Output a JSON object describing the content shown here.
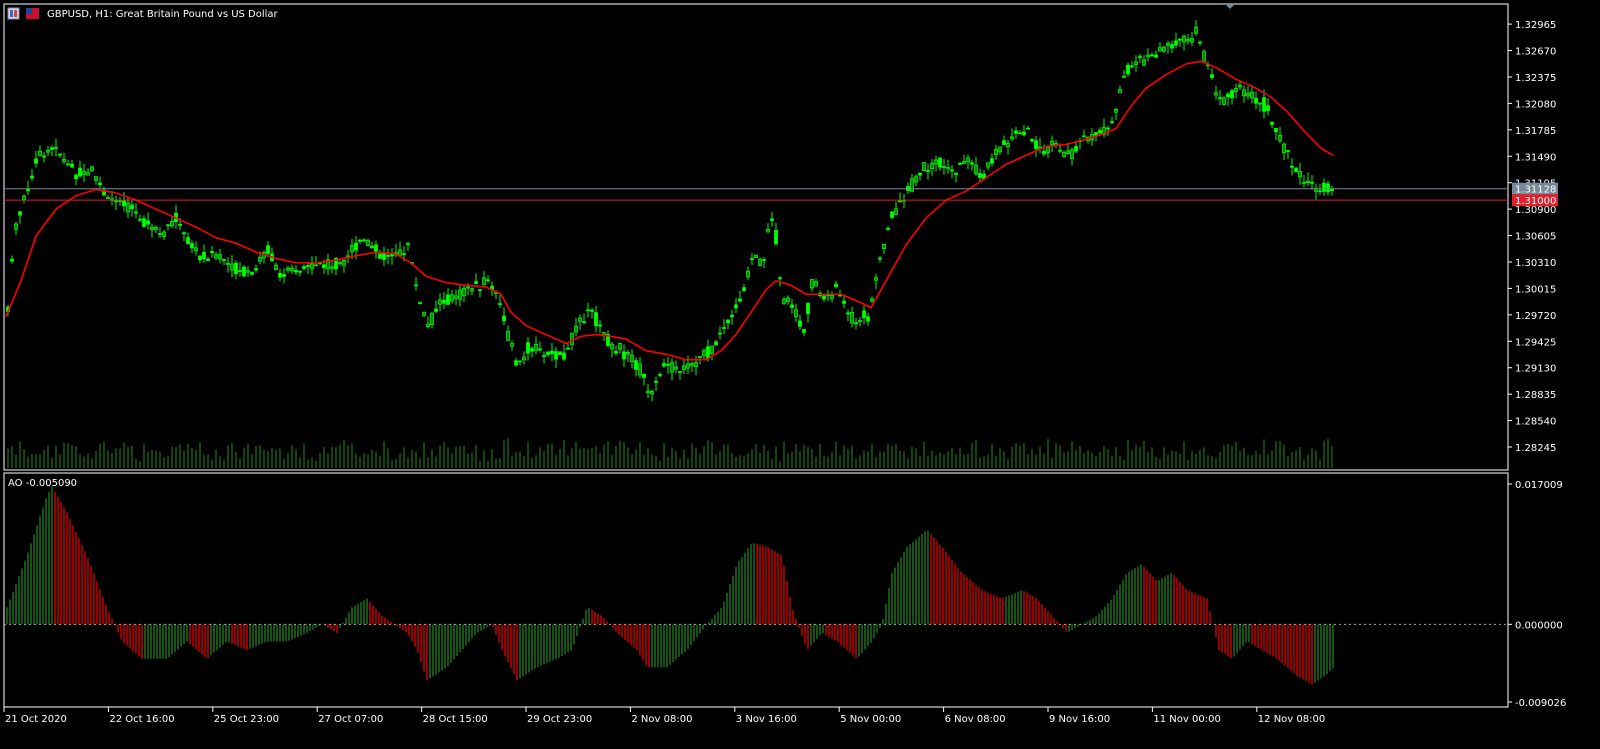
{
  "header": {
    "symbol_title": "GBPUSD, H1:  Great Britain Pound vs US Dollar",
    "ao_label": "AO -0.005090"
  },
  "price_panel": {
    "bid_line": {
      "value": 1.31128,
      "label": "1.31128",
      "color": "#778899"
    },
    "ask_line": {
      "value": 1.31,
      "label": "1.31000",
      "color": "#e0202c"
    },
    "y_ticks": [
      "1.32965",
      "1.32670",
      "1.32375",
      "1.32080",
      "1.31785",
      "1.31490",
      "1.31195",
      "1.30900",
      "1.30605",
      "1.30310",
      "1.30015",
      "1.29720",
      "1.29425",
      "1.29130",
      "1.28835",
      "1.28540",
      "1.28245"
    ]
  },
  "ao_panel": {
    "y_ticks": [
      "0.017009",
      "0.000000",
      "-0.009026"
    ]
  },
  "x_ticks": [
    "21 Oct 2020",
    "22 Oct 16:00",
    "25 Oct 23:00",
    "27 Oct 07:00",
    "28 Oct 15:00",
    "29 Oct 23:00",
    "2 Nov 08:00",
    "3 Nov 16:00",
    "5 Nov 00:00",
    "6 Nov 08:00",
    "9 Nov 16:00",
    "11 Nov 00:00",
    "12 Nov 08:00"
  ],
  "colors": {
    "background": "#000000",
    "frame": "#ffffff",
    "bull_candle": "#00ff00",
    "ma_line": "#ff0000",
    "volume": "#228b22",
    "ao_up": "#228b22",
    "ao_down": "#ff0000",
    "axis_text": "#ffffff",
    "zero_line": "#aaaaaa"
  },
  "chart_data": [
    {
      "type": "candlestick",
      "title": "GBPUSD, H1:  Great Britain Pound vs US Dollar",
      "ylim": [
        1.281,
        1.331
      ],
      "approximate": true,
      "price_path": [
        [
          0,
          1.298
        ],
        [
          7,
          1.307
        ],
        [
          20,
          1.3115
        ],
        [
          30,
          1.315
        ],
        [
          45,
          1.316
        ],
        [
          55,
          1.3145
        ],
        [
          70,
          1.313
        ],
        [
          85,
          1.3135
        ],
        [
          95,
          1.311
        ],
        [
          110,
          1.3095
        ],
        [
          125,
          1.309
        ],
        [
          140,
          1.3075
        ],
        [
          155,
          1.3065
        ],
        [
          170,
          1.308
        ],
        [
          180,
          1.3055
        ],
        [
          195,
          1.3035
        ],
        [
          210,
          1.304
        ],
        [
          225,
          1.3025
        ],
        [
          245,
          1.302
        ],
        [
          260,
          1.3045
        ],
        [
          275,
          1.3015
        ],
        [
          290,
          1.302
        ],
        [
          310,
          1.303
        ],
        [
          325,
          1.3025
        ],
        [
          340,
          1.304
        ],
        [
          355,
          1.306
        ],
        [
          370,
          1.304
        ],
        [
          385,
          1.3035
        ],
        [
          400,
          1.305
        ],
        [
          410,
          1.2995
        ],
        [
          420,
          1.296
        ],
        [
          432,
          1.2985
        ],
        [
          445,
          1.299
        ],
        [
          460,
          1.3
        ],
        [
          480,
          1.301
        ],
        [
          490,
          1.2995
        ],
        [
          500,
          1.295
        ],
        [
          510,
          1.291
        ],
        [
          520,
          1.2935
        ],
        [
          535,
          1.293
        ],
        [
          555,
          1.2925
        ],
        [
          570,
          1.296
        ],
        [
          580,
          1.298
        ],
        [
          595,
          1.2955
        ],
        [
          605,
          1.2935
        ],
        [
          620,
          1.293
        ],
        [
          635,
          1.2905
        ],
        [
          642,
          1.2885
        ],
        [
          655,
          1.2915
        ],
        [
          670,
          1.291
        ],
        [
          690,
          1.292
        ],
        [
          705,
          1.2935
        ],
        [
          720,
          1.2965
        ],
        [
          735,
          1.2995
        ],
        [
          745,
          1.304
        ],
        [
          755,
          1.303
        ],
        [
          765,
          1.309
        ],
        [
          775,
          1.299
        ],
        [
          785,
          1.2985
        ],
        [
          795,
          1.295
        ],
        [
          805,
          1.301
        ],
        [
          815,
          1.299
        ],
        [
          830,
          1.3
        ],
        [
          845,
          1.2965
        ],
        [
          860,
          1.297
        ],
        [
          870,
          1.302
        ],
        [
          880,
          1.307
        ],
        [
          890,
          1.3095
        ],
        [
          905,
          1.312
        ],
        [
          915,
          1.3135
        ],
        [
          930,
          1.314
        ],
        [
          945,
          1.313
        ],
        [
          960,
          1.3145
        ],
        [
          975,
          1.3125
        ],
        [
          990,
          1.3155
        ],
        [
          1005,
          1.317
        ],
        [
          1020,
          1.3175
        ],
        [
          1035,
          1.315
        ],
        [
          1045,
          1.3165
        ],
        [
          1060,
          1.315
        ],
        [
          1075,
          1.3165
        ],
        [
          1090,
          1.3175
        ],
        [
          1105,
          1.3185
        ],
        [
          1115,
          1.324
        ],
        [
          1130,
          1.3255
        ],
        [
          1150,
          1.3265
        ],
        [
          1165,
          1.3275
        ],
        [
          1180,
          1.328
        ],
        [
          1188,
          1.329
        ],
        [
          1195,
          1.3265
        ],
        [
          1205,
          1.323
        ],
        [
          1215,
          1.321
        ],
        [
          1230,
          1.3225
        ],
        [
          1245,
          1.3215
        ],
        [
          1258,
          1.3205
        ],
        [
          1268,
          1.318
        ],
        [
          1280,
          1.315
        ],
        [
          1290,
          1.313
        ],
        [
          1300,
          1.312
        ],
        [
          1310,
          1.3115
        ],
        [
          1325,
          1.3112
        ]
      ],
      "ma_path": [
        [
          0,
          1.297
        ],
        [
          15,
          1.301
        ],
        [
          30,
          1.306
        ],
        [
          50,
          1.309
        ],
        [
          70,
          1.3105
        ],
        [
          90,
          1.3112
        ],
        [
          110,
          1.3108
        ],
        [
          130,
          1.31
        ],
        [
          150,
          1.309
        ],
        [
          170,
          1.308
        ],
        [
          190,
          1.307
        ],
        [
          210,
          1.3058
        ],
        [
          230,
          1.3052
        ],
        [
          250,
          1.3042
        ],
        [
          270,
          1.3035
        ],
        [
          290,
          1.303
        ],
        [
          310,
          1.303
        ],
        [
          330,
          1.3033
        ],
        [
          350,
          1.3038
        ],
        [
          370,
          1.3042
        ],
        [
          390,
          1.304
        ],
        [
          405,
          1.303
        ],
        [
          420,
          1.3015
        ],
        [
          440,
          1.3008
        ],
        [
          460,
          1.3005
        ],
        [
          480,
          1.3003
        ],
        [
          495,
          1.2995
        ],
        [
          505,
          1.2975
        ],
        [
          520,
          1.296
        ],
        [
          540,
          1.295
        ],
        [
          560,
          1.294
        ],
        [
          575,
          1.2948
        ],
        [
          590,
          1.295
        ],
        [
          605,
          1.2948
        ],
        [
          620,
          1.2945
        ],
        [
          640,
          1.2932
        ],
        [
          660,
          1.2928
        ],
        [
          680,
          1.2922
        ],
        [
          700,
          1.2922
        ],
        [
          715,
          1.2932
        ],
        [
          730,
          1.295
        ],
        [
          745,
          1.2975
        ],
        [
          760,
          1.3
        ],
        [
          770,
          1.301
        ],
        [
          785,
          1.3005
        ],
        [
          800,
          1.2995
        ],
        [
          815,
          1.2995
        ],
        [
          835,
          1.2995
        ],
        [
          850,
          1.2988
        ],
        [
          865,
          1.298
        ],
        [
          880,
          1.301
        ],
        [
          900,
          1.305
        ],
        [
          920,
          1.308
        ],
        [
          940,
          1.31
        ],
        [
          960,
          1.311
        ],
        [
          980,
          1.3125
        ],
        [
          1000,
          1.314
        ],
        [
          1020,
          1.315
        ],
        [
          1040,
          1.316
        ],
        [
          1060,
          1.3162
        ],
        [
          1080,
          1.3168
        ],
        [
          1100,
          1.3175
        ],
        [
          1110,
          1.318
        ],
        [
          1125,
          1.3205
        ],
        [
          1140,
          1.3225
        ],
        [
          1160,
          1.324
        ],
        [
          1180,
          1.3252
        ],
        [
          1195,
          1.3255
        ],
        [
          1210,
          1.3248
        ],
        [
          1230,
          1.3235
        ],
        [
          1250,
          1.3225
        ],
        [
          1265,
          1.3215
        ],
        [
          1280,
          1.32
        ],
        [
          1300,
          1.3175
        ],
        [
          1315,
          1.3158
        ],
        [
          1327,
          1.315
        ]
      ]
    },
    {
      "type": "bar",
      "title": "AO -0.005090",
      "ylim": [
        -0.009026,
        0.017009
      ],
      "approximate": true,
      "ao_path": [
        [
          0,
          0.002
        ],
        [
          20,
          0.008
        ],
        [
          40,
          0.015
        ],
        [
          45,
          0.016
        ],
        [
          60,
          0.013
        ],
        [
          80,
          0.008
        ],
        [
          100,
          0.002
        ],
        [
          115,
          -0.002
        ],
        [
          135,
          -0.004
        ],
        [
          160,
          -0.004
        ],
        [
          180,
          -0.002
        ],
        [
          200,
          -0.004
        ],
        [
          220,
          -0.002
        ],
        [
          240,
          -0.003
        ],
        [
          260,
          -0.002
        ],
        [
          280,
          -0.002
        ],
        [
          300,
          -0.001
        ],
        [
          315,
          0.0
        ],
        [
          330,
          -0.001
        ],
        [
          345,
          0.002
        ],
        [
          360,
          0.003
        ],
        [
          375,
          0.001
        ],
        [
          400,
          -0.001
        ],
        [
          410,
          -0.003
        ],
        [
          420,
          -0.0065
        ],
        [
          440,
          -0.005
        ],
        [
          455,
          -0.003
        ],
        [
          470,
          -0.001
        ],
        [
          485,
          0.0
        ],
        [
          495,
          -0.003
        ],
        [
          510,
          -0.0065
        ],
        [
          530,
          -0.005
        ],
        [
          550,
          -0.004
        ],
        [
          565,
          -0.003
        ],
        [
          580,
          0.002
        ],
        [
          595,
          0.001
        ],
        [
          610,
          -0.001
        ],
        [
          630,
          -0.003
        ],
        [
          640,
          -0.005
        ],
        [
          660,
          -0.005
        ],
        [
          680,
          -0.003
        ],
        [
          700,
          0.0
        ],
        [
          715,
          0.002
        ],
        [
          730,
          0.007
        ],
        [
          745,
          0.0095
        ],
        [
          760,
          0.009
        ],
        [
          775,
          0.008
        ],
        [
          785,
          0.002
        ],
        [
          800,
          -0.003
        ],
        [
          815,
          -0.001
        ],
        [
          830,
          -0.002
        ],
        [
          850,
          -0.004
        ],
        [
          865,
          -0.002
        ],
        [
          875,
          0.0
        ],
        [
          885,
          0.006
        ],
        [
          900,
          0.009
        ],
        [
          920,
          0.011
        ],
        [
          935,
          0.009
        ],
        [
          955,
          0.006
        ],
        [
          975,
          0.004
        ],
        [
          995,
          0.003
        ],
        [
          1015,
          0.004
        ],
        [
          1030,
          0.003
        ],
        [
          1045,
          0.001
        ],
        [
          1060,
          -0.001
        ],
        [
          1075,
          0.0
        ],
        [
          1090,
          0.001
        ],
        [
          1105,
          0.003
        ],
        [
          1120,
          0.006
        ],
        [
          1135,
          0.007
        ],
        [
          1150,
          0.005
        ],
        [
          1165,
          0.006
        ],
        [
          1180,
          0.004
        ],
        [
          1200,
          0.003
        ],
        [
          1212,
          -0.003
        ],
        [
          1225,
          -0.004
        ],
        [
          1240,
          -0.002
        ],
        [
          1255,
          -0.003
        ],
        [
          1270,
          -0.004
        ],
        [
          1290,
          -0.006
        ],
        [
          1305,
          -0.007
        ],
        [
          1318,
          -0.006
        ],
        [
          1327,
          -0.005
        ]
      ]
    }
  ]
}
